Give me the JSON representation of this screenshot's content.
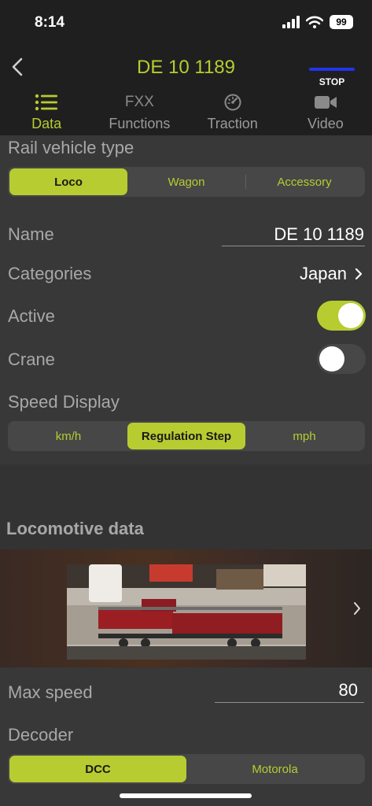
{
  "status": {
    "time": "8:14",
    "battery": "99"
  },
  "nav": {
    "title": "DE 10 1189",
    "stop_label": "STOP"
  },
  "tabs": [
    {
      "label": "Data",
      "icon": "list-icon",
      "active": true
    },
    {
      "label": "Functions",
      "icon": "fxx-icon",
      "icon_text": "FXX",
      "active": false
    },
    {
      "label": "Traction",
      "icon": "gauge-icon",
      "active": false
    },
    {
      "label": "Video",
      "icon": "video-camera-icon",
      "active": false
    }
  ],
  "vehicle_type": {
    "label": "Rail vehicle type",
    "options": [
      "Loco",
      "Wagon",
      "Accessory"
    ],
    "selected": "Loco"
  },
  "name": {
    "label": "Name",
    "value": "DE 10 1189"
  },
  "categories": {
    "label": "Categories",
    "value": "Japan"
  },
  "active": {
    "label": "Active",
    "on": true
  },
  "crane": {
    "label": "Crane",
    "on": false
  },
  "speed_display": {
    "label": "Speed Display",
    "options": [
      "km/h",
      "Regulation Step",
      "mph"
    ],
    "selected": "Regulation Step"
  },
  "loco_data": {
    "title": "Locomotive data"
  },
  "max_speed": {
    "label": "Max speed",
    "value": "80"
  },
  "decoder": {
    "label": "Decoder",
    "options": [
      "DCC",
      "Motorola"
    ],
    "selected": "DCC"
  },
  "colors": {
    "accent": "#b7cc30",
    "background": "#383838",
    "bar": "#1f1f1f",
    "stop_bar": "#2233ee"
  }
}
